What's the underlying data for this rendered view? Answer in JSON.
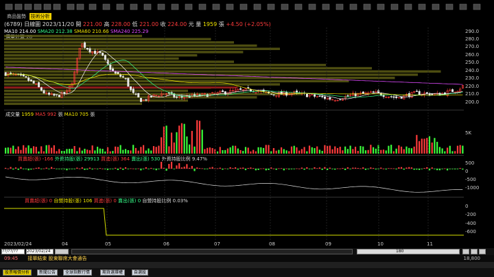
{
  "top": {
    "tabs": [
      "商品盤勢",
      "技術分析"
    ],
    "active_tab": 1
  },
  "quote": {
    "symbol": "(6789)",
    "period": "日線圖",
    "date": "2023/11/20",
    "open_label": "開",
    "open": "221.00",
    "high_label": "高",
    "high": "228.00",
    "low_label": "低",
    "low": "221.00",
    "close_label": "收",
    "close": "224.00",
    "unit": "元",
    "volume_label": "量",
    "volume": "1959",
    "volume_unit": "張",
    "change": "+4.50 (+2.05%)"
  },
  "ma_line": {
    "ma10": "MA10 214.00",
    "ma20": "SMA20 212.38",
    "ma60": "SMA60 210.66",
    "ma240": "SMA240 225.29",
    "sub_label": "價量計算 20"
  },
  "price_axis": [
    "290.0",
    "280.0",
    "270.0",
    "260.0",
    "250.0",
    "240.0",
    "230.0",
    "220.0",
    "210.0",
    "200.0"
  ],
  "volume_panel": {
    "label": "成交量",
    "value": "1959",
    "ma5_label": "MA5",
    "ma5": "992",
    "ma10_label": "MA10",
    "ma10": "705",
    "unit": "張",
    "axis": [
      "5K"
    ]
  },
  "foreign_panel": {
    "items": [
      "買賣超(張) -166",
      "外資持股(張) 29913",
      "買進(張) 364",
      "賣出(張) 530",
      "外資持股比例 9.47%"
    ],
    "axis": [
      "500",
      "0",
      "-500",
      "-1000"
    ]
  },
  "dealer_panel": {
    "items": [
      "買賣超(張) 0",
      "自營持股(張) 106",
      "買進(張) 0",
      "賣出(張) 0",
      "自營持股比例 0.03%"
    ],
    "axis": [
      "0",
      "-200",
      "-400",
      "-600"
    ]
  },
  "date_axis": [
    "2023/02/24",
    "04",
    "05",
    "06",
    "07",
    "08",
    "09",
    "10",
    "11"
  ],
  "scroll": {
    "start_field": "??/??/??",
    "start_date": "2023/02/24",
    "zoom": "180"
  },
  "bottom_status": {
    "time": "09:45",
    "message": "接單結束 股東聯席大會通告",
    "right_value": "18,800"
  },
  "taskbar": [
    "股票報價分析",
    "新聞公告",
    "全球指數行情",
    "期貨選擇權",
    "自選股"
  ]
}
